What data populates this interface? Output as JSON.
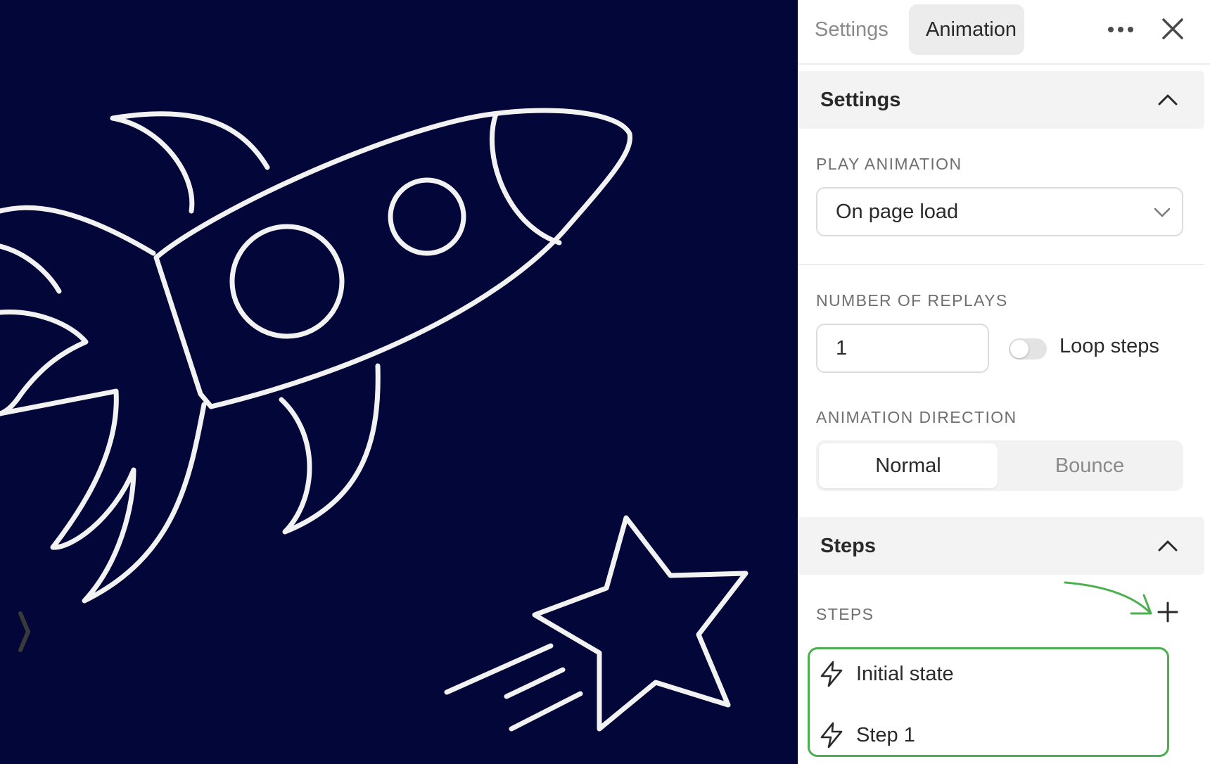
{
  "tabs": [
    {
      "label": "Settings",
      "active": false
    },
    {
      "label": "Animation",
      "active": true
    }
  ],
  "icons": {
    "more": "more-horizontal-icon",
    "close": "close-icon",
    "collapse": "chevron-up-icon",
    "dropdown": "chevron-down-icon",
    "add": "plus-icon",
    "step": "lightning-bolt-icon"
  },
  "settings_section": {
    "title": "Settings",
    "play_animation": {
      "label": "PLAY ANIMATION",
      "value": "On page load"
    },
    "number_of_replays": {
      "label": "NUMBER OF REPLAYS",
      "value": "1"
    },
    "loop_steps": {
      "label": "Loop steps",
      "enabled": false
    },
    "animation_direction": {
      "label": "ANIMATION DIRECTION",
      "options": [
        "Normal",
        "Bounce"
      ],
      "selected": "Normal"
    }
  },
  "steps_section": {
    "title": "Steps",
    "label": "STEPS",
    "items": [
      {
        "label": "Initial state"
      },
      {
        "label": "Step 1"
      }
    ]
  },
  "colors": {
    "canvas_background": "#020638",
    "illustration_stroke": "#f2f2f2",
    "highlight": "#4caf50"
  }
}
